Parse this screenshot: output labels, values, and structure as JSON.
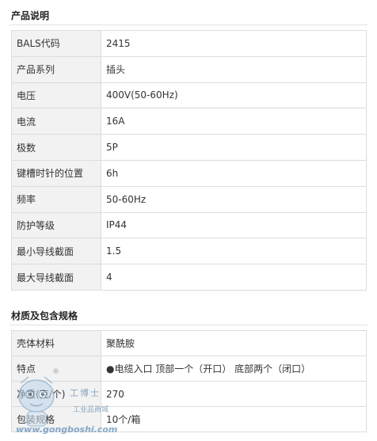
{
  "sections": [
    {
      "title": "产品说明",
      "rows": [
        {
          "key": "BALS代码",
          "value": "2415"
        },
        {
          "key": "产品系列",
          "value": "插头"
        },
        {
          "key": "电压",
          "value": "400V(50-60Hz)"
        },
        {
          "key": "电流",
          "value": "16A"
        },
        {
          "key": "极数",
          "value": "5P"
        },
        {
          "key": "键槽时针的位置",
          "value": "6h"
        },
        {
          "key": "频率",
          "value": "50-60Hz"
        },
        {
          "key": "防护等级",
          "value": "IP44"
        },
        {
          "key": "最小导线截面",
          "value": "1.5"
        },
        {
          "key": "最大导线截面",
          "value": "4"
        }
      ]
    },
    {
      "title": "材质及包含规格",
      "rows": [
        {
          "key": "壳体材料",
          "value": "聚酰胺"
        },
        {
          "key": "特点",
          "value": "●电缆入口 顶部一个（开口） 底部两个（闭口）"
        },
        {
          "key": "净重(克/个)",
          "value": "270"
        },
        {
          "key": "包装规格",
          "value": "10个/箱"
        }
      ]
    }
  ],
  "watermark": {
    "name": "工博士",
    "subtitle": "工业品商城",
    "url": "www.gongboshi.com",
    "registered_mark": "®",
    "icon": "robot-mascot-icon"
  }
}
